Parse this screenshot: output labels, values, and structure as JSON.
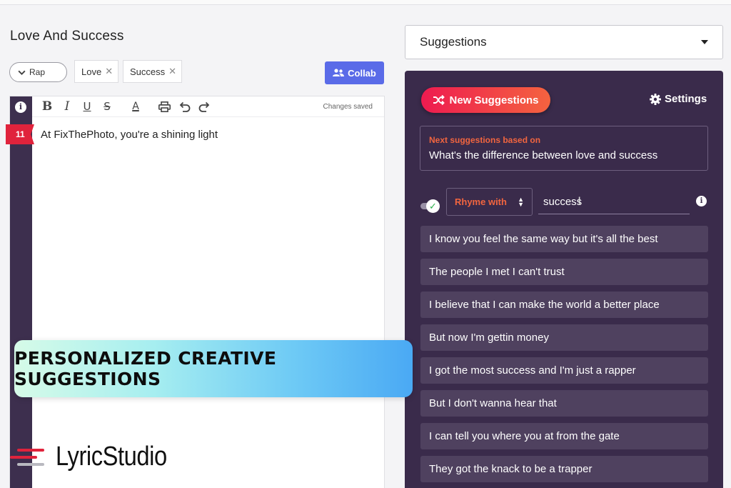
{
  "song": {
    "title": "Love And Success",
    "genre": "Rap",
    "tags": [
      "Love",
      "Success"
    ],
    "collab_label": "Collab"
  },
  "editor": {
    "status": "Changes saved",
    "line_number": "11",
    "lyrics": [
      "At FixThePhoto, you're a shining light"
    ],
    "toolbar_icons": [
      "bold-icon",
      "italic-icon",
      "underline-icon",
      "strikethrough-icon",
      "text-color-icon",
      "print-icon",
      "undo-icon",
      "redo-icon"
    ]
  },
  "panel_select": {
    "value": "Suggestions"
  },
  "suggestions": {
    "new_button": "New Suggestions",
    "settings_label": "Settings",
    "next_label": "Next suggestions based on",
    "next_text": "What's the difference between love and success",
    "rhyme_mode": "Rhyme with",
    "rhyme_word": "success",
    "rhyme_toggle_on": true,
    "items": [
      "I know you feel the same way but it's all the best",
      "The people I met I can't trust",
      "I believe that I can make the world a better place",
      "But now I'm gettin money",
      "I got the most success and I'm just a rapper",
      "But I don't wanna hear that",
      "I can tell you where you at from the gate",
      "They got the knack to be a trapper"
    ]
  },
  "overlay": {
    "banner": "PERSONALIZED CREATIVE SUGGESTIONS",
    "logo_text": "LyricStudio"
  },
  "colors": {
    "panel_bg": "#3a2b4b",
    "item_bg": "#4f415f",
    "accent_orange": "#f2653f",
    "accent_red": "#e0233c",
    "collab_blue": "#5a6be8",
    "toggle_green": "#2bb04a"
  }
}
